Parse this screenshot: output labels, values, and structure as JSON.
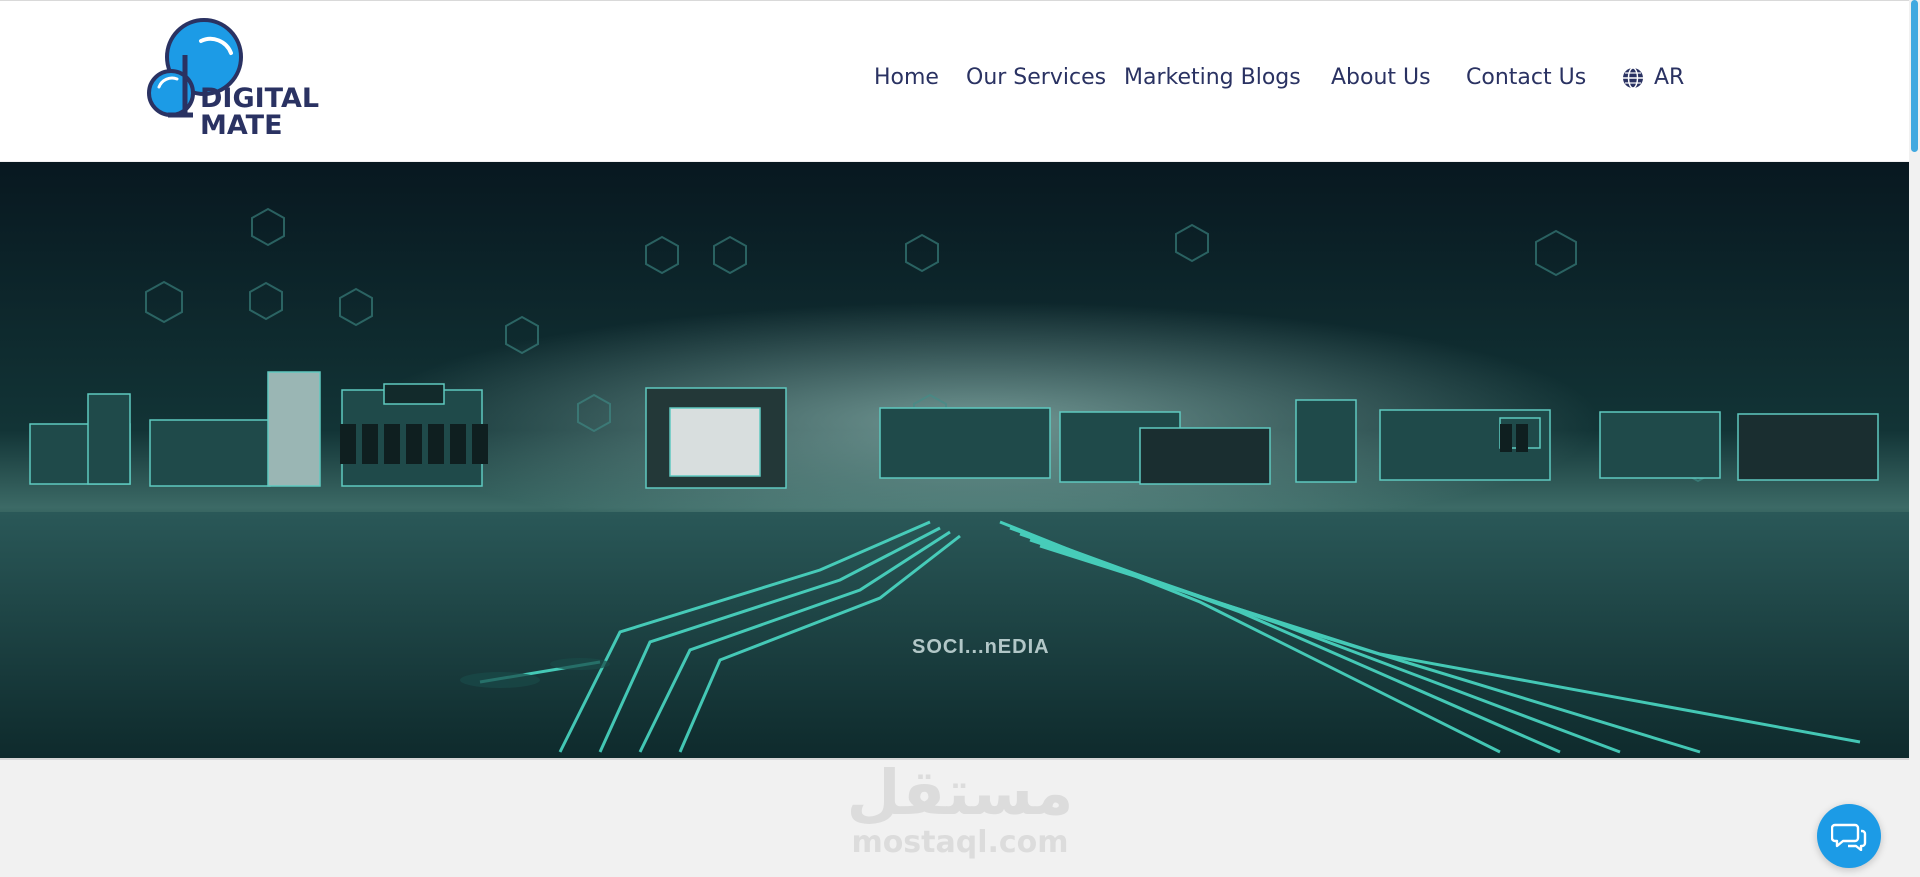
{
  "brand": {
    "line1": "DIGITAL",
    "line2": "MATE",
    "color": "#2a3262",
    "accent": "#1c9be6"
  },
  "nav": {
    "items": [
      {
        "label": "Home"
      },
      {
        "label": "Our Services"
      },
      {
        "label": "Marketing Blogs"
      },
      {
        "label": "About Us"
      },
      {
        "label": "Contact Us"
      }
    ],
    "language": {
      "label": "AR",
      "icon": "globe-icon"
    }
  },
  "hero": {
    "caption": "SOCI...nEDIA"
  },
  "watermark": {
    "arabic": "مستقل",
    "latin": "mostaql.com"
  },
  "chat": {
    "icon": "chat-bubbles-icon"
  }
}
